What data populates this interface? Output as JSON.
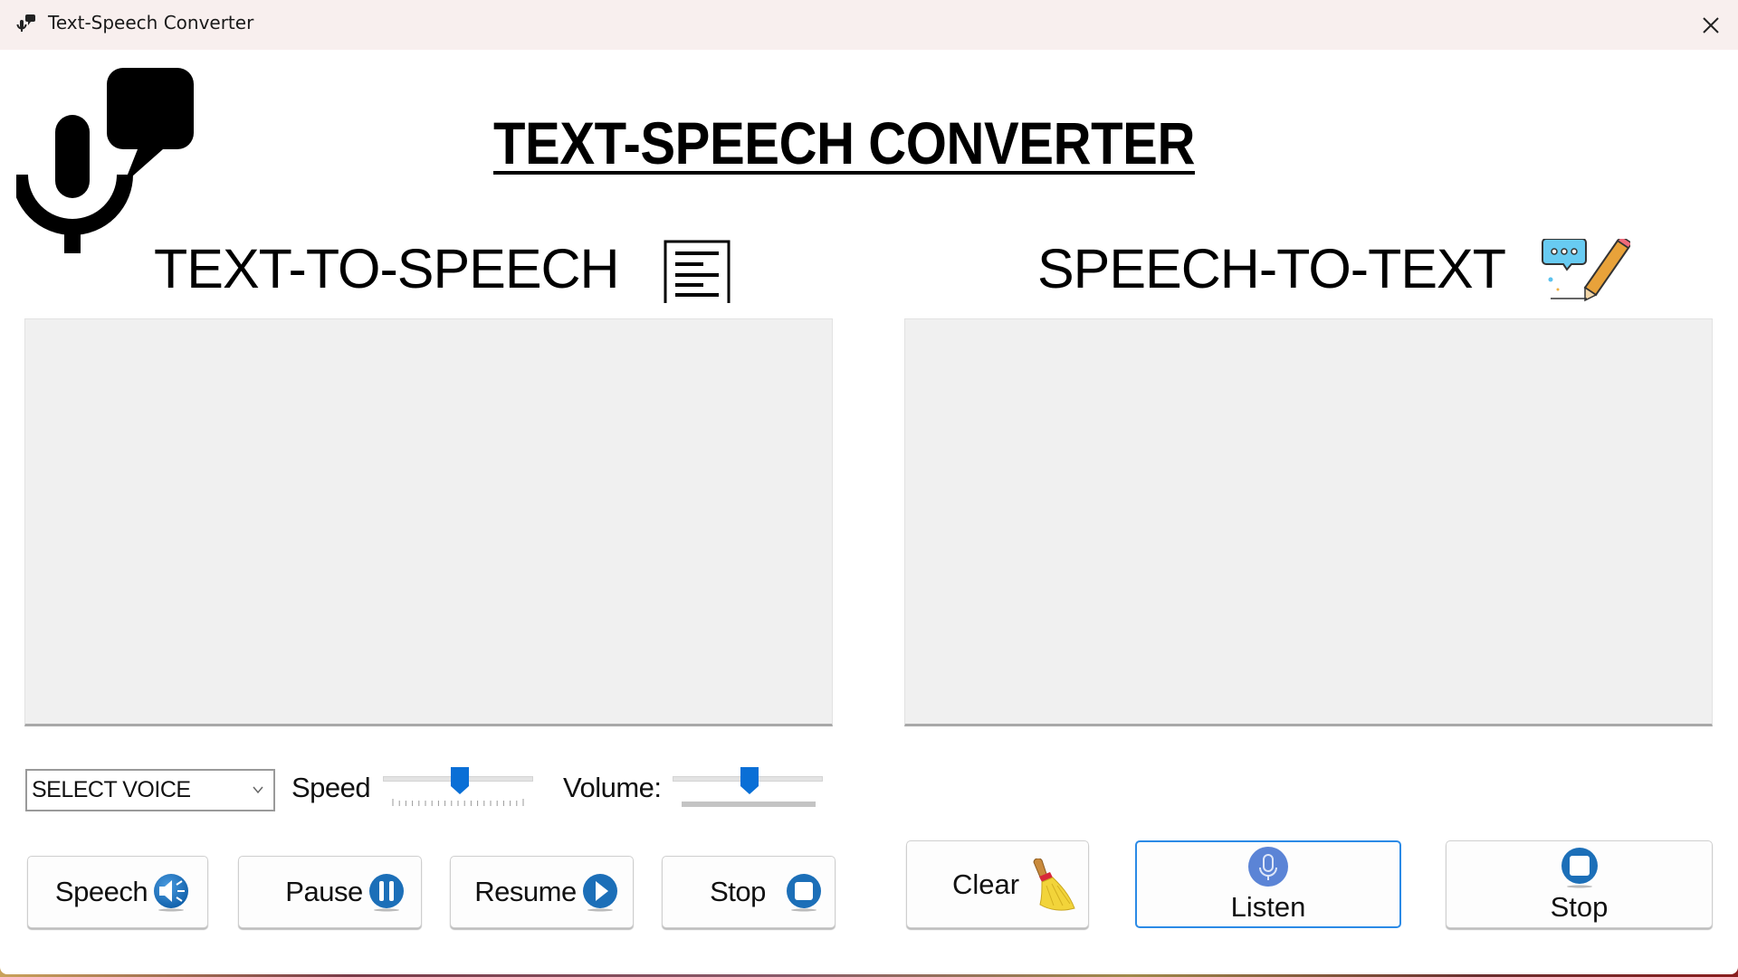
{
  "window": {
    "title": "Text-Speech Converter",
    "app_icon": "mic-speech-icon",
    "close_icon": "close-icon"
  },
  "header": {
    "logo_icon": "mic-speech-bubble-logo",
    "title": "TEXT-SPEECH CONVERTER"
  },
  "tts": {
    "heading": "TEXT-TO-SPEECH",
    "heading_icon": "document-lines-icon",
    "text_value": "",
    "voice_select": {
      "selected": "SELECT VOICE"
    },
    "speed": {
      "label": "Speed",
      "value_fraction": 0.51
    },
    "volume": {
      "label": "Volume:",
      "value_fraction": 0.51
    },
    "buttons": [
      {
        "label": "Speech",
        "icon": "speaker-icon"
      },
      {
        "label": "Pause",
        "icon": "pause-icon"
      },
      {
        "label": "Resume",
        "icon": "play-icon"
      },
      {
        "label": "Stop",
        "icon": "stop-icon"
      }
    ]
  },
  "stt": {
    "heading": "SPEECH-TO-TEXT",
    "heading_icon": "chat-pencil-icon",
    "text_value": "",
    "buttons": [
      {
        "label": "Clear",
        "icon": "broom-icon"
      },
      {
        "label": "Listen",
        "icon": "microphone-icon"
      },
      {
        "label": "Stop",
        "icon": "stop-icon"
      }
    ]
  },
  "colors": {
    "accent_blue": "#0a6fd6",
    "button_icon_blue": "#1c6fb8",
    "listen_icon_blue": "#5b84d6",
    "focus_border": "#2b8ae6",
    "titlebar_bg": "#f8efee",
    "textbox_bg": "#f0f0f0"
  }
}
